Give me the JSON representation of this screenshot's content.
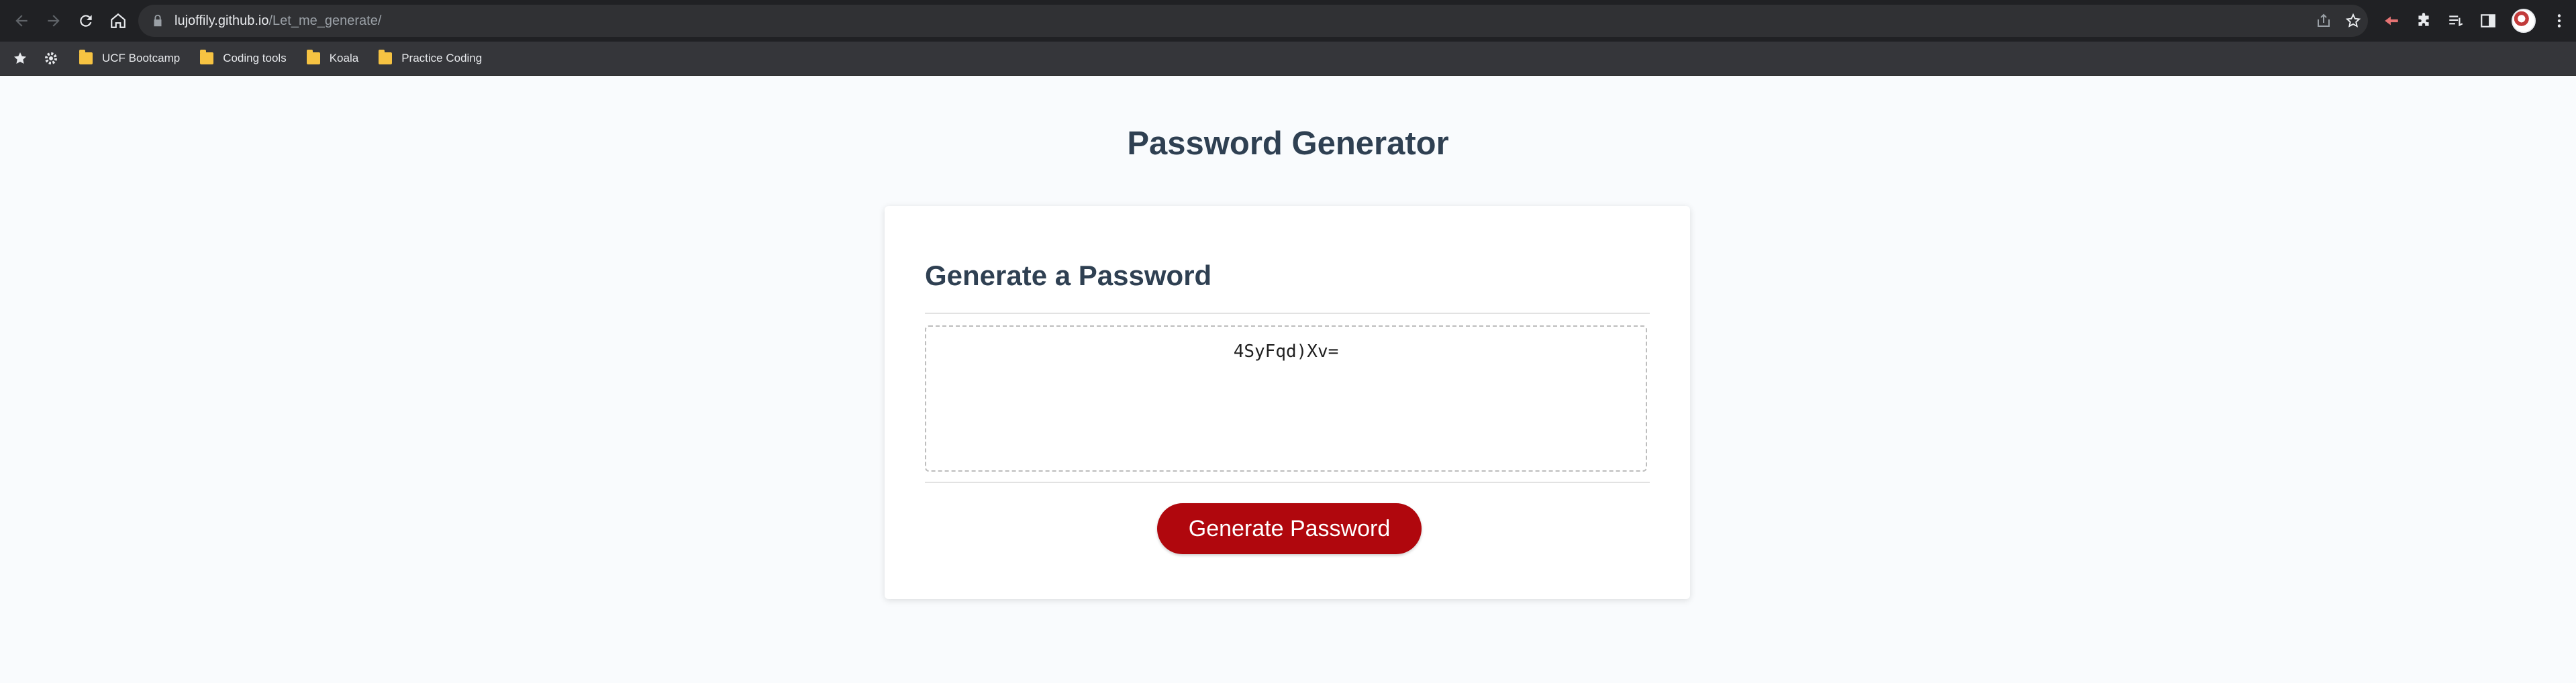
{
  "browser": {
    "url_host": "lujoffily.github.io",
    "url_path": "/Let_me_generate/",
    "bookmarks": [
      {
        "label": "UCF Bootcamp"
      },
      {
        "label": "Coding tools"
      },
      {
        "label": "Koala"
      },
      {
        "label": "Practice Coding"
      }
    ]
  },
  "page": {
    "title": "Password Generator",
    "card_title": "Generate a Password",
    "password": "4SyFqd)Xv=",
    "generate_button": "Generate Password"
  },
  "colors": {
    "brand_red": "#b0070d",
    "heading": "#2f4052",
    "chrome_dark": "#202124"
  }
}
